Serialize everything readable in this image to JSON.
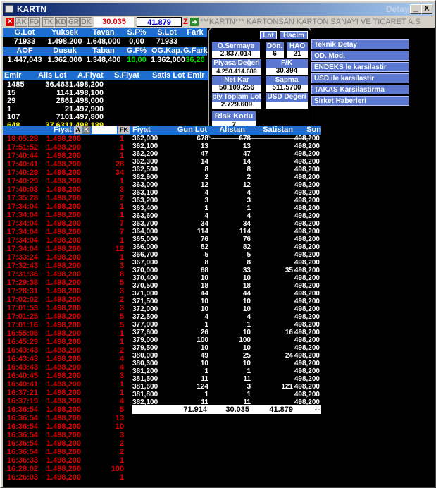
{
  "window": {
    "title": "KARTN",
    "detay": "Detay",
    "min_label": "_",
    "close_label": "X"
  },
  "toolbar": {
    "buttons": [
      "AK",
      "FD",
      "TK",
      "KD",
      "GR",
      "DK"
    ],
    "last_price": "30.035",
    "second_price": "41.879",
    "z_label": "Z",
    "company_name": "***KARTN*** KARTONSAN KARTON SANAYI VE TICARET A.S"
  },
  "stats_row1": {
    "headers": [
      "G.Lot",
      "Yuksek",
      "Tavan",
      "S.F%",
      "S.Lot",
      "Fark"
    ],
    "values": [
      "71933",
      "1.498,200",
      "1.648,000",
      "0,00",
      "71933",
      ""
    ]
  },
  "stats_row2": {
    "headers": [
      "AOF",
      "Dusuk",
      "Taban",
      "G.F%",
      "OG.Kap.",
      "G.Fark"
    ],
    "values": [
      "1.447,043",
      "1.362,000",
      "1.348,400",
      "10,00",
      "1.362,000",
      "36,20"
    ]
  },
  "orders": {
    "headers": [
      "Emir",
      "Alis Lot",
      "A.Fiyat",
      "S.Fiyat",
      "Satis Lot",
      "Emir"
    ],
    "rows": [
      [
        "1485",
        "36.463",
        "1.498,200"
      ],
      [
        "15",
        "114",
        "1.498,100"
      ],
      [
        "29",
        "286",
        "1.498,000"
      ],
      [
        "1",
        "2",
        "1.497,900"
      ],
      [
        "107",
        "710",
        "1.497,800"
      ],
      [
        "648",
        "37.631",
        "1.498,189"
      ]
    ]
  },
  "popup": {
    "lot_button": "Lot",
    "hacim_button": "Hacim",
    "o_sermaye_label": "O.Sermaye",
    "o_sermaye_value": "2.837.014",
    "don_label": "Dön.",
    "don_value": "6",
    "hao_label": "HAO",
    "hao_value": "21",
    "piyasa_label": "Piyasa Değeri",
    "piyasa_value": "4.250.414.689",
    "fk_label": "F/K",
    "fk_value": "30.394",
    "netkar_label": "Net Kar",
    "netkar_value": "50.109.256",
    "sapma_label": "Sapma",
    "sapma_value": "511.5700",
    "toplam_label": "piy.Toplam Lot",
    "toplam_value": "2.729.609",
    "usd_label": "USD Değeri",
    "usd_value": "",
    "risk_label": "Risk Kodu",
    "risk_value": "Z"
  },
  "menu_items": [
    "Teknik Detay",
    "OD. Mod.",
    "ENDEKS le karsilastir",
    "USD ile karsilastir",
    "TAKAS Karsilastirma",
    "Sirket Haberleri"
  ],
  "trades": {
    "header_fiyat": "Fiyat",
    "a_label": "A",
    "k_label": "K",
    "fk_label": "FK",
    "rows": [
      [
        "18:05:28",
        "1.498,200",
        "1"
      ],
      [
        "17:51:52",
        "1.498,200",
        "1"
      ],
      [
        "17:40:44",
        "1.498,200",
        "1"
      ],
      [
        "17:40:41",
        "1.498,200",
        "28"
      ],
      [
        "17:40:29",
        "1.498,200",
        "34"
      ],
      [
        "17:40:29",
        "1.498,200",
        "1"
      ],
      [
        "17:40:03",
        "1.498,200",
        "3"
      ],
      [
        "17:35:28",
        "1.498,200",
        "2"
      ],
      [
        "17:34:04",
        "1.498,200",
        "1"
      ],
      [
        "17:34:04",
        "1.498,200",
        "1"
      ],
      [
        "17:34:04",
        "1.498,200",
        "7"
      ],
      [
        "17:34:04",
        "1.498,200",
        "7"
      ],
      [
        "17:34:04",
        "1.498,200",
        "1"
      ],
      [
        "17:34:04",
        "1.498,200",
        "12"
      ],
      [
        "17:33:24",
        "1.498,200",
        "1"
      ],
      [
        "17:32:43",
        "1.498,200",
        "3"
      ],
      [
        "17:31:36",
        "1.498,200",
        "8"
      ],
      [
        "17:29:38",
        "1.498,200",
        "5"
      ],
      [
        "17:28:31",
        "1.498,200",
        "3"
      ],
      [
        "17:02:02",
        "1.498,200",
        "2"
      ],
      [
        "17:01:59",
        "1.498,200",
        "3"
      ],
      [
        "17:01:25",
        "1.498,200",
        "5"
      ],
      [
        "17:01:16",
        "1.498,200",
        "5"
      ],
      [
        "16:55:06",
        "1.498,200",
        "1"
      ],
      [
        "16:45:29",
        "1.498,200",
        "1"
      ],
      [
        "16:43:43",
        "1.498,200",
        "2"
      ],
      [
        "16:43:43",
        "1.498,200",
        "4"
      ],
      [
        "16:43:43",
        "1.498,200",
        "4"
      ],
      [
        "16:40:45",
        "1.498,200",
        "3"
      ],
      [
        "16:40:41",
        "1.498,200",
        "1"
      ],
      [
        "16:37:21",
        "1.498,200",
        "1"
      ],
      [
        "16:37:19",
        "1.498,200",
        "4"
      ],
      [
        "16:36:54",
        "1.498,200",
        "5"
      ],
      [
        "16:36:54",
        "1.498,200",
        "13"
      ],
      [
        "16:36:54",
        "1.498,200",
        "10"
      ],
      [
        "16:36:54",
        "1.498,200",
        "3"
      ],
      [
        "16:36:54",
        "1.498,200",
        "2"
      ],
      [
        "16:36:54",
        "1.498,200",
        "2"
      ],
      [
        "16:36:33",
        "1.498,200",
        "1"
      ],
      [
        "16:28:02",
        "1.498,200",
        "100"
      ],
      [
        "16:26:03",
        "1.498,200",
        "1"
      ]
    ]
  },
  "depth": {
    "headers": [
      "Fiyat",
      "Gun Lot",
      "Alistan",
      "Satistan",
      "Son"
    ],
    "rows": [
      [
        "362,000",
        "678",
        "678",
        "",
        "498,200"
      ],
      [
        "362,100",
        "13",
        "13",
        "",
        "498,200"
      ],
      [
        "362,200",
        "47",
        "47",
        "",
        "498,200"
      ],
      [
        "362,300",
        "14",
        "14",
        "",
        "498,200"
      ],
      [
        "362,500",
        "8",
        "8",
        "",
        "498,200"
      ],
      [
        "362,900",
        "2",
        "2",
        "",
        "498,200"
      ],
      [
        "363,000",
        "12",
        "12",
        "",
        "498,200"
      ],
      [
        "363,100",
        "4",
        "4",
        "",
        "498,200"
      ],
      [
        "363,200",
        "3",
        "3",
        "",
        "498,200"
      ],
      [
        "363,400",
        "1",
        "1",
        "",
        "498,200"
      ],
      [
        "363,600",
        "4",
        "4",
        "",
        "498,200"
      ],
      [
        "363,700",
        "34",
        "34",
        "",
        "498,200"
      ],
      [
        "364,000",
        "114",
        "114",
        "",
        "498,200"
      ],
      [
        "365,000",
        "76",
        "76",
        "",
        "498,200"
      ],
      [
        "366,000",
        "82",
        "82",
        "",
        "498,200"
      ],
      [
        "366,700",
        "5",
        "5",
        "",
        "498,200"
      ],
      [
        "367,000",
        "8",
        "8",
        "",
        "498,200"
      ],
      [
        "370,000",
        "68",
        "33",
        "35",
        "498,200"
      ],
      [
        "370,400",
        "10",
        "10",
        "",
        "498,200"
      ],
      [
        "370,500",
        "18",
        "18",
        "",
        "498,200"
      ],
      [
        "371,000",
        "44",
        "44",
        "",
        "498,200"
      ],
      [
        "371,500",
        "10",
        "10",
        "",
        "498,200"
      ],
      [
        "372,000",
        "10",
        "10",
        "",
        "498,200"
      ],
      [
        "372,500",
        "4",
        "4",
        "",
        "498,200"
      ],
      [
        "377,000",
        "1",
        "1",
        "",
        "498,200"
      ],
      [
        "377,600",
        "26",
        "10",
        "16",
        "498,200"
      ],
      [
        "379,000",
        "100",
        "100",
        "",
        "498,200"
      ],
      [
        "379,500",
        "10",
        "10",
        "",
        "498,200"
      ],
      [
        "380,000",
        "49",
        "25",
        "24",
        "498,200"
      ],
      [
        "380,300",
        "10",
        "10",
        "",
        "498,200"
      ],
      [
        "381,200",
        "1",
        "1",
        "",
        "498,200"
      ],
      [
        "381,500",
        "11",
        "11",
        "",
        "498,200"
      ],
      [
        "381,600",
        "124",
        "3",
        "121",
        "498,200"
      ],
      [
        "381,800",
        "1",
        "1",
        "",
        "498,200"
      ],
      [
        "382,100",
        "11",
        "11",
        "",
        "498,200"
      ]
    ],
    "totals": [
      "71.914",
      "30.035",
      "41.879",
      "--"
    ]
  }
}
